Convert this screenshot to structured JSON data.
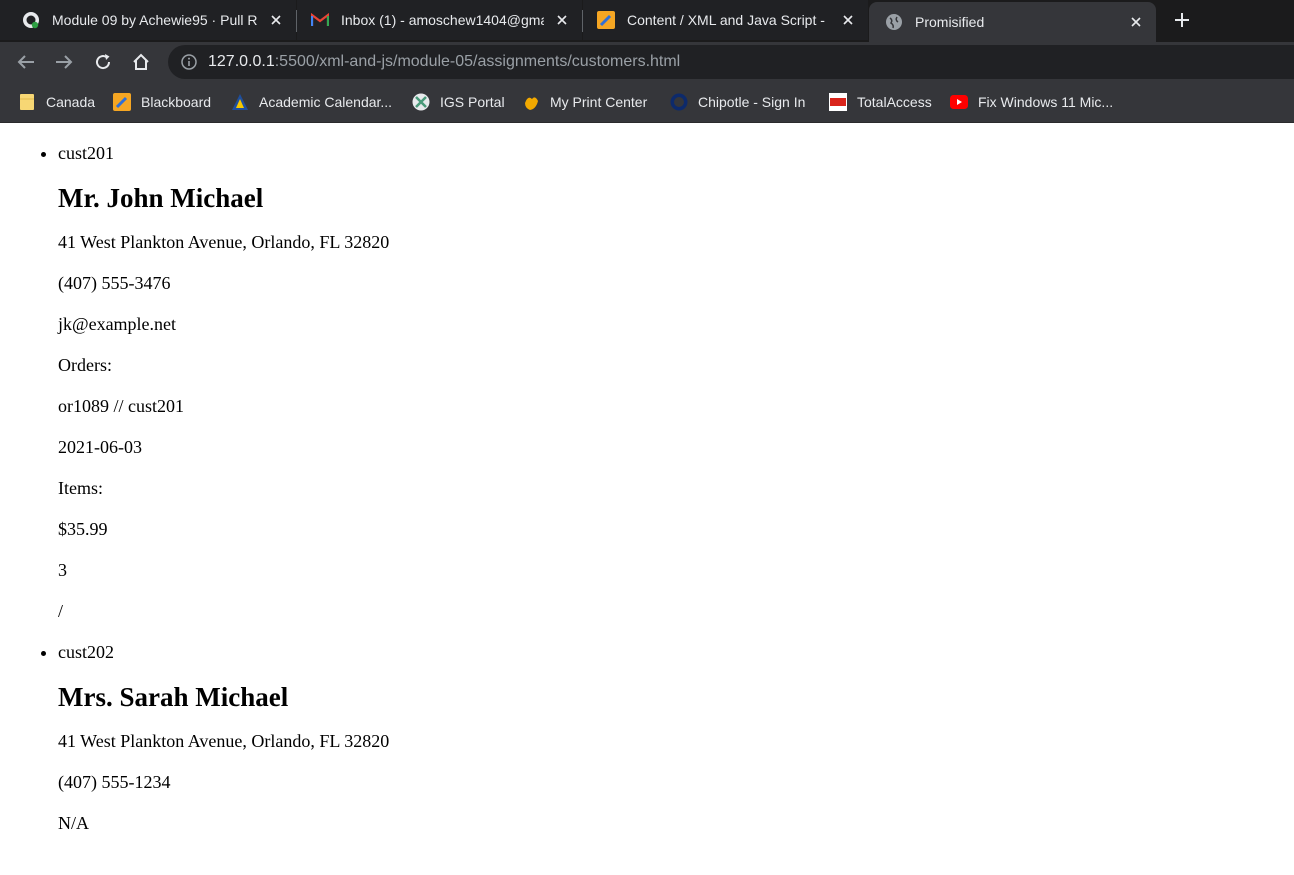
{
  "browser": {
    "tabs": [
      {
        "title": "Module 09 by Achewie95 · Pull R",
        "favicon": "github-icon",
        "active": false
      },
      {
        "title": "Inbox (1) - amoschew1404@gma",
        "favicon": "gmail-icon",
        "active": false
      },
      {
        "title": "Content / XML and Java Script - I",
        "favicon": "pencil-icon",
        "active": false
      },
      {
        "title": "Promisified",
        "favicon": "globe-icon",
        "active": true
      }
    ],
    "url_host": "127.0.0.1",
    "url_rest": ":5500/xml-and-js/module-05/assignments/customers.html",
    "bookmarks": [
      {
        "label": "Canada",
        "icon": "folder-icon"
      },
      {
        "label": "Blackboard",
        "icon": "blackboard-icon"
      },
      {
        "label": "Academic Calendar...",
        "icon": "calendar-icon"
      },
      {
        "label": "IGS Portal",
        "icon": "portal-icon"
      },
      {
        "label": "My Print Center",
        "icon": "print-icon"
      },
      {
        "label": "Chipotle - Sign In",
        "icon": "chipotle-icon"
      },
      {
        "label": "TotalAccess",
        "icon": "totalaccess-icon"
      },
      {
        "label": "Fix Windows 11 Mic...",
        "icon": "youtube-icon"
      }
    ]
  },
  "customers": [
    {
      "id": "cust201",
      "name": "Mr. John Michael",
      "address": "41 West Plankton Avenue, Orlando, FL 32820",
      "phone": "(407) 555-3476",
      "email": "jk@example.net",
      "orders_label": "Orders:",
      "order_ref": "or1089 // cust201",
      "order_date": "2021-06-03",
      "items_label": "Items:",
      "price": "$35.99",
      "quantity": "3",
      "separator": "/"
    },
    {
      "id": "cust202",
      "name": "Mrs. Sarah Michael",
      "address": "41 West Plankton Avenue, Orlando, FL 32820",
      "phone": "(407) 555-1234",
      "email": "N/A"
    }
  ]
}
